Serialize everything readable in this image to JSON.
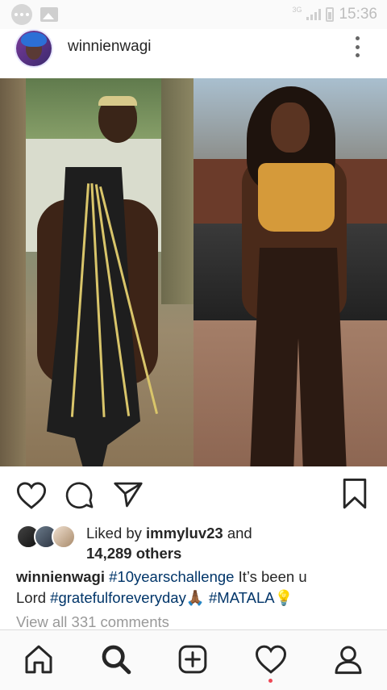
{
  "status_bar": {
    "time": "15:36",
    "network": "3G",
    "icons": [
      "messages-icon",
      "image-icon",
      "signal-icon",
      "battery-icon"
    ]
  },
  "post": {
    "username": "winnienwagi",
    "likes": {
      "liked_by_prefix": "Liked by ",
      "liked_by_user": "immyluv23",
      "and_text": " and",
      "others_count": "14,289 others"
    },
    "caption": {
      "username": "winnienwagi",
      "hashtag1": "#10yearschallenge",
      "text1": " It’s been u",
      "text2": "Lord ",
      "hashtag2": "#gratefulforeveryday",
      "emoji1": "🙏🏾",
      "hashtag3": " #MATALA",
      "emoji2": "💡"
    },
    "view_comments": "View all 331 comments"
  },
  "colors": {
    "text": "#262626",
    "hashtag": "#003569",
    "muted": "#999999",
    "notification_dot": "#ed4956"
  },
  "bottom_nav": [
    "home-icon",
    "search-icon",
    "add-post-icon",
    "activity-heart-icon",
    "profile-icon"
  ]
}
